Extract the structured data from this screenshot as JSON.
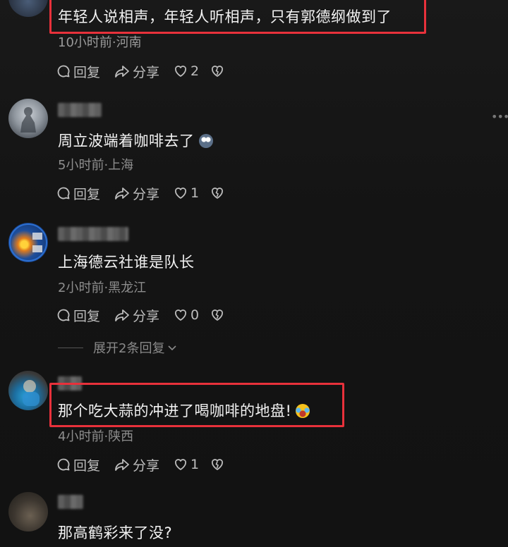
{
  "comments": [
    {
      "text": "年轻人说相声，年轻人听相声，只有郭德纲做到了",
      "meta": "10小时前·河南",
      "reply_label": "回复",
      "share_label": "分享",
      "like_count": "2",
      "highlighted": true
    },
    {
      "text": "周立波端着咖啡去了",
      "emoji": "cat-face-emoji",
      "meta": "5小时前·上海",
      "reply_label": "回复",
      "share_label": "分享",
      "like_count": "1"
    },
    {
      "text": "上海德云社谁是队长",
      "meta": "2小时前·黑龙江",
      "reply_label": "回复",
      "share_label": "分享",
      "like_count": "0",
      "expand_replies": "展开2条回复"
    },
    {
      "text": "那个吃大蒜的冲进了喝咖啡的地盘!",
      "emoji": "laughing-tears-emoji",
      "meta": "4小时前·陕西",
      "reply_label": "回复",
      "share_label": "分享",
      "like_count": "1",
      "highlighted": true
    },
    {
      "text": "那高鹤彩来了没?"
    }
  ],
  "colors": {
    "highlight": "#e8313b",
    "background": "#161616",
    "meta_text": "#8e8e8e"
  }
}
